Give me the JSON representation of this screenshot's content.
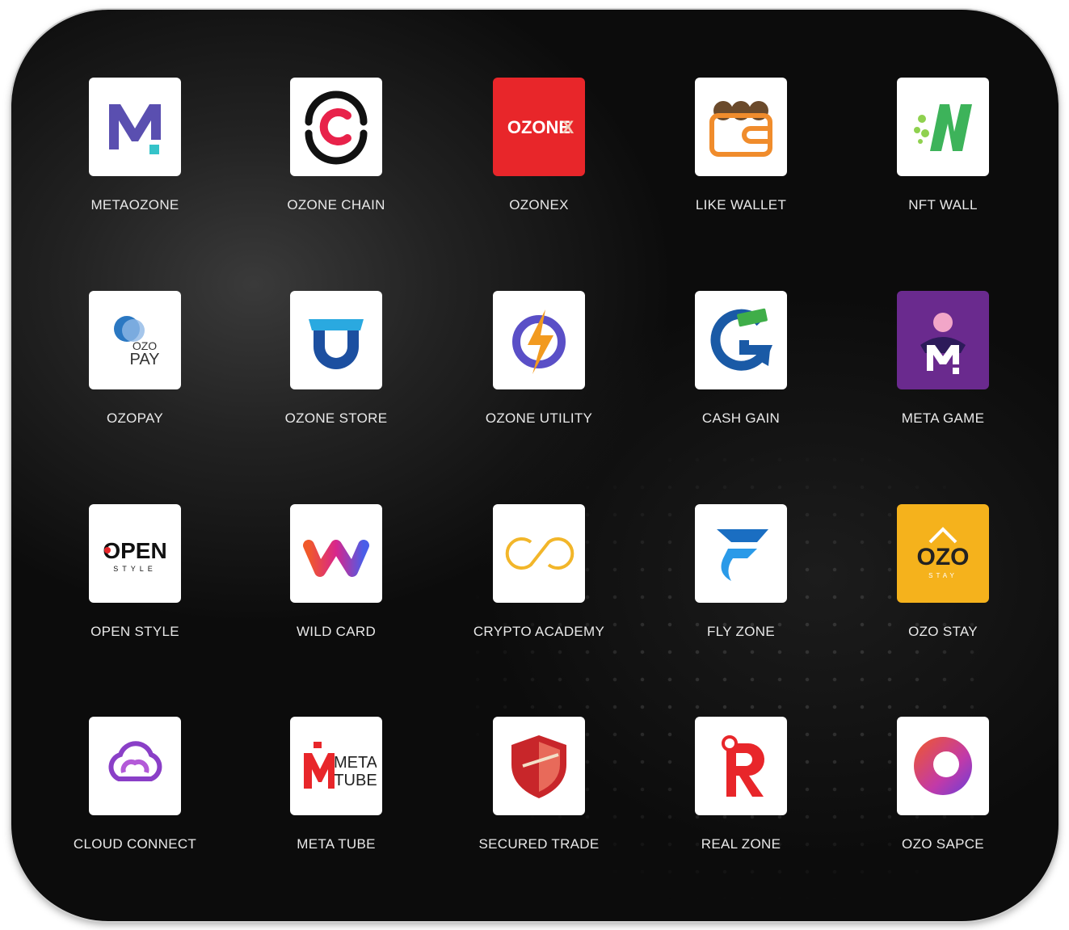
{
  "apps": [
    {
      "label": "METAOZONE",
      "icon": "metaozone-icon",
      "bg": "#ffffff"
    },
    {
      "label": "OZONE CHAIN",
      "icon": "ozone-chain-icon",
      "bg": "#ffffff"
    },
    {
      "label": "OZONEX",
      "icon": "ozonex-icon",
      "bg": "#e8262a",
      "logo_text": "OZONEX"
    },
    {
      "label": "LIKE WALLET",
      "icon": "wallet-icon",
      "bg": "#ffffff"
    },
    {
      "label": "NFT WALL",
      "icon": "nft-wall-icon",
      "bg": "#ffffff"
    },
    {
      "label": "OZOPAY",
      "icon": "ozopay-icon",
      "bg": "#ffffff",
      "logo_text": "OZO PAY"
    },
    {
      "label": "OZONE STORE",
      "icon": "store-icon",
      "bg": "#ffffff"
    },
    {
      "label": "OZONE UTILITY",
      "icon": "utility-icon",
      "bg": "#ffffff"
    },
    {
      "label": "CASH GAIN",
      "icon": "cash-gain-icon",
      "bg": "#ffffff"
    },
    {
      "label": "META GAME",
      "icon": "meta-game-icon",
      "bg": "#6a2a8e"
    },
    {
      "label": "OPEN STYLE",
      "icon": "open-style-icon",
      "bg": "#ffffff",
      "logo_text": "OPEN STYLE"
    },
    {
      "label": "WILD CARD",
      "icon": "wild-card-icon",
      "bg": "#ffffff"
    },
    {
      "label": "CRYPTO ACADEMY",
      "icon": "crypto-academy-icon",
      "bg": "#ffffff"
    },
    {
      "label": "FLY ZONE",
      "icon": "fly-zone-icon",
      "bg": "#ffffff"
    },
    {
      "label": "OZO STAY",
      "icon": "ozo-stay-icon",
      "bg": "#f5b21c",
      "logo_text": "OZO STAY"
    },
    {
      "label": "CLOUD CONNECT",
      "icon": "cloud-connect-icon",
      "bg": "#ffffff"
    },
    {
      "label": "META TUBE",
      "icon": "meta-tube-icon",
      "bg": "#ffffff",
      "logo_text": "META TUBE"
    },
    {
      "label": "SECURED TRADE",
      "icon": "shield-icon",
      "bg": "#ffffff"
    },
    {
      "label": "REAL ZONE",
      "icon": "real-zone-icon",
      "bg": "#ffffff"
    },
    {
      "label": "OZO SAPCE",
      "icon": "ozo-space-icon",
      "bg": "#ffffff"
    }
  ]
}
